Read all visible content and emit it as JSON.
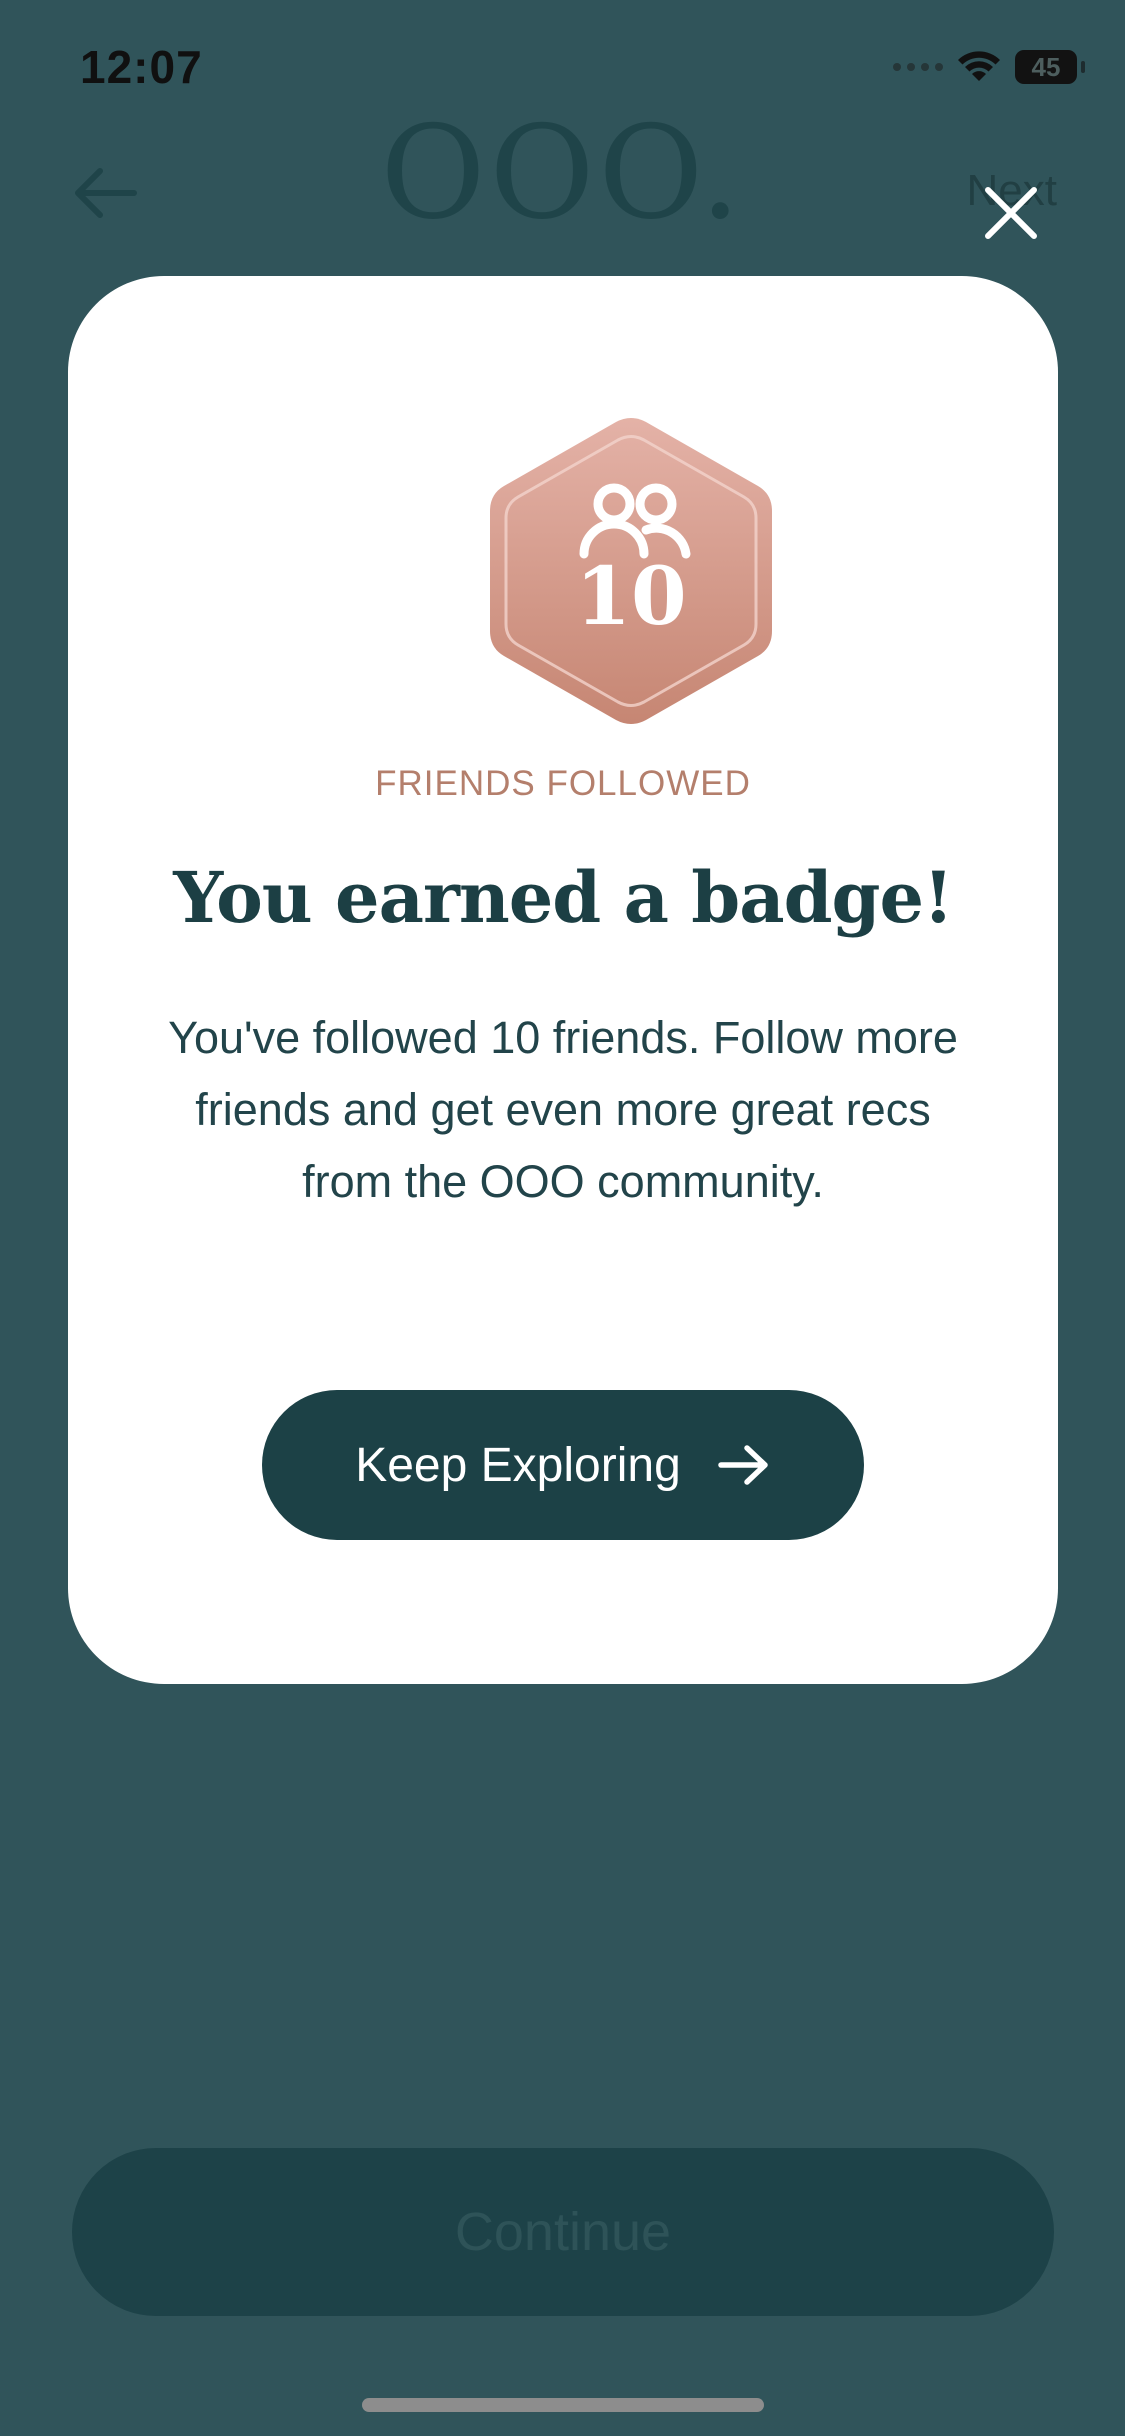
{
  "status_bar": {
    "time": "12:07",
    "battery_level": "45"
  },
  "header": {
    "logo": "OOO.",
    "next_label": "Next"
  },
  "modal": {
    "badge": {
      "count": "10",
      "icon": "people-icon",
      "label": "FRIENDS FOLLOWED"
    },
    "title": "You earned a badge!",
    "body": "You've followed 10 friends. Follow more friends and get even more great recs from the OOO community.",
    "cta_label": "Keep Exploring",
    "cta_icon": "arrow-right-icon",
    "close_icon": "close-icon"
  },
  "footer": {
    "continue_label": "Continue"
  },
  "colors": {
    "backdrop": "#30545a",
    "card": "#ffffff",
    "primary": "#1c4146",
    "badge_gradient_top": "#e1aea3",
    "badge_gradient_bottom": "#c98a78",
    "badge_label": "#b47f6c"
  }
}
